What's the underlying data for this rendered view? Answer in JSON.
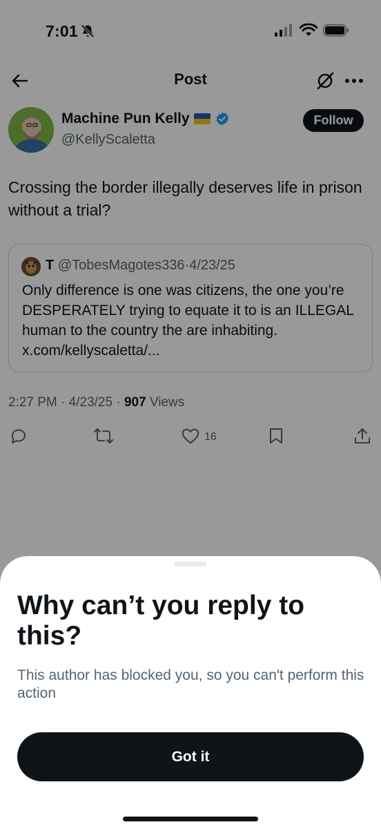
{
  "status_bar": {
    "time": "7:01"
  },
  "header": {
    "title": "Post"
  },
  "post": {
    "author_name": "Machine Pun Kelly",
    "author_handle": "@KellyScaletta",
    "follow_label": "Follow",
    "text": "Crossing the border illegally deserves life in prison without a trial?",
    "quote": {
      "name": "T",
      "handle": "@TobesMagotes336",
      "separator": "·",
      "date": "4/23/25",
      "text": "Only difference is one was citizens, the one you’re DESPERATELY trying to equate it to is an ILLEGAL human to the country the are inhabiting. x.com/kellyscaletta/..."
    },
    "meta": {
      "time": "2:27 PM",
      "date": "4/23/25",
      "views_count": "907",
      "views_label": "Views"
    },
    "actions": {
      "like_count": "16"
    }
  },
  "sheet": {
    "title": "Why can’t you reply to this?",
    "body": "This author has blocked you, so you can't perform this action",
    "button_label": "Got it"
  },
  "colors": {
    "text_primary": "#0f1419",
    "text_secondary": "#536471",
    "verified_blue": "#1d9bf0",
    "button_dark": "#0f1419",
    "overlay": "rgba(0,0,0,0.40)"
  }
}
